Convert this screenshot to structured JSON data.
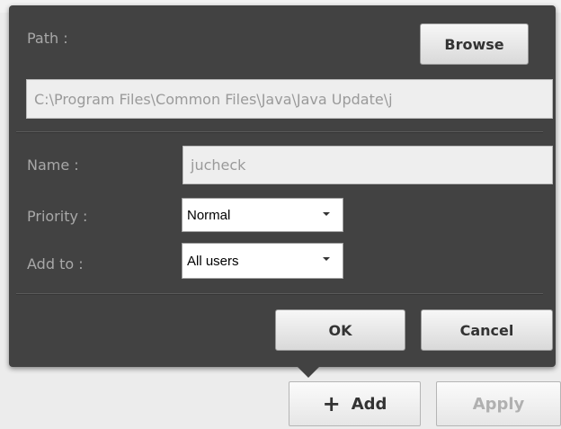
{
  "dialog": {
    "path_label": "Path :",
    "browse_label": "Browse",
    "path_value": "C:\\Program Files\\Common Files\\Java\\Java Update\\j",
    "name_label": "Name :",
    "name_value": "jucheck",
    "priority_label": "Priority :",
    "priority_value": "Normal",
    "addto_label": "Add to :",
    "addto_value": "All users",
    "ok_label": "OK",
    "cancel_label": "Cancel"
  },
  "footer": {
    "add_icon": "+",
    "add_label": "Add",
    "apply_label": "Apply"
  },
  "icons": {
    "add": "plus-icon",
    "dropdown": "chevron-down-icon"
  },
  "colors": {
    "popup_bg": "#424242",
    "label": "#a8a8a8",
    "window_bg": "#ececec"
  }
}
